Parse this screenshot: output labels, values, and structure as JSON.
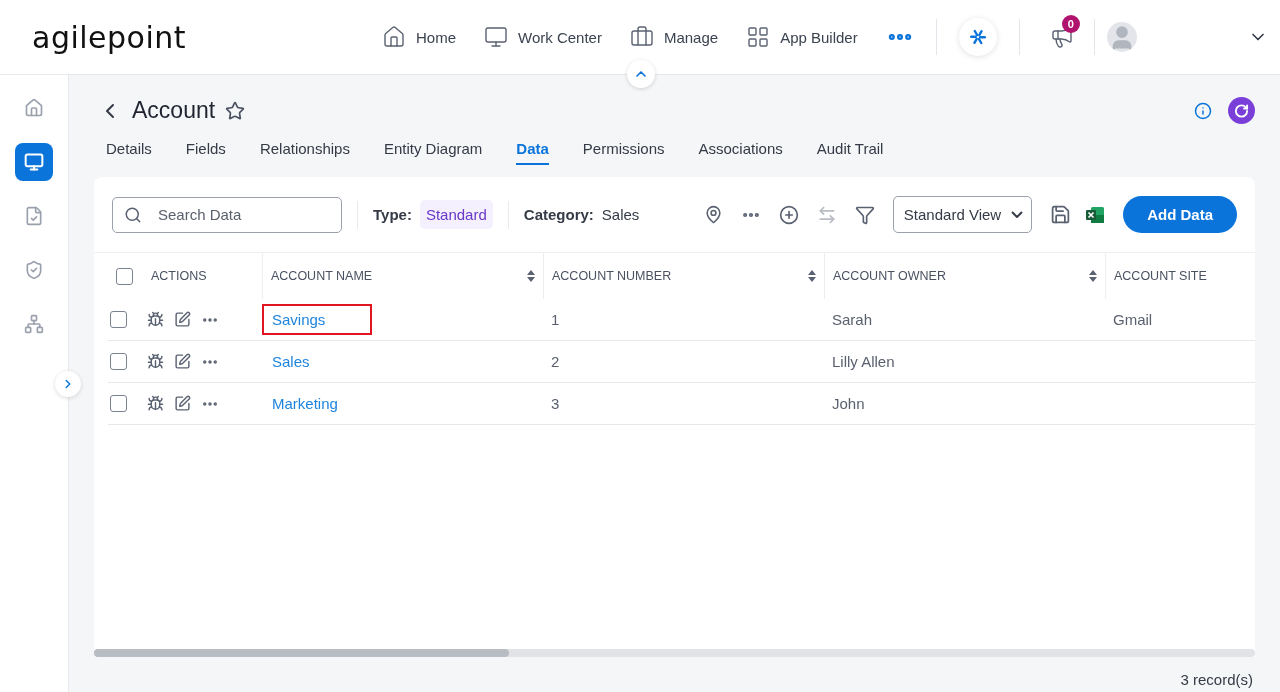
{
  "logo": {
    "text": "agilepoint"
  },
  "nav": [
    {
      "label": "Home"
    },
    {
      "label": "Work Center"
    },
    {
      "label": "Manage"
    },
    {
      "label": "App Builder"
    }
  ],
  "notifications": {
    "count": "0"
  },
  "sidebar": {
    "items": [
      {
        "selected": false
      },
      {
        "selected": true
      },
      {
        "selected": false
      },
      {
        "selected": false
      },
      {
        "selected": false
      }
    ]
  },
  "page": {
    "title": "Account"
  },
  "tabs": [
    {
      "label": "Details",
      "selected": false
    },
    {
      "label": "Fields",
      "selected": false
    },
    {
      "label": "Relationships",
      "selected": false
    },
    {
      "label": "Entity Diagram",
      "selected": false
    },
    {
      "label": "Data",
      "selected": true
    },
    {
      "label": "Permissions",
      "selected": false
    },
    {
      "label": "Associations",
      "selected": false
    },
    {
      "label": "Audit Trail",
      "selected": false
    }
  ],
  "toolbar": {
    "search": {
      "placeholder": "Search Data"
    },
    "type": {
      "label": "Type:",
      "value": "Standard"
    },
    "category": {
      "label": "Category:",
      "value": "Sales"
    },
    "view": "Standard View",
    "add_button": "Add Data"
  },
  "table": {
    "all_checked": false,
    "columns": [
      {
        "label": "ACTIONS"
      },
      {
        "label": "ACCOUNT NAME"
      },
      {
        "label": "ACCOUNT NUMBER"
      },
      {
        "label": "ACCOUNT OWNER"
      },
      {
        "label": "ACCOUNT SITE"
      }
    ],
    "rows": [
      {
        "checked": false,
        "highlighted": true,
        "cells": [
          "",
          "Savings",
          "1",
          "Sarah",
          "Gmail"
        ]
      },
      {
        "checked": false,
        "highlighted": false,
        "cells": [
          "",
          "Sales",
          "2",
          "Lilly Allen",
          ""
        ]
      },
      {
        "checked": false,
        "highlighted": false,
        "cells": [
          "",
          "Marketing",
          "3",
          "John",
          ""
        ]
      }
    ]
  },
  "footer": {
    "records": "3 record(s)"
  }
}
